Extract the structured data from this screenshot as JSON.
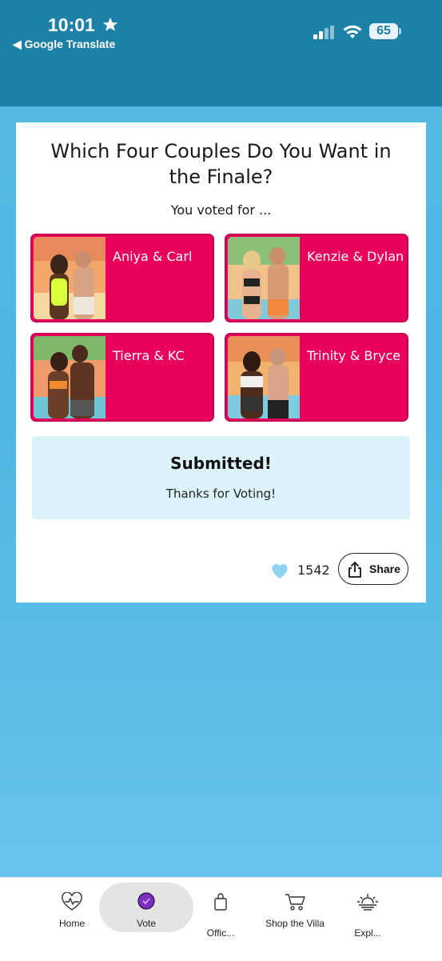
{
  "status": {
    "time": "10:01",
    "back_app": "◀ Google Translate",
    "battery": "65"
  },
  "poll": {
    "title": "Which Four Couples Do You Want in the Finale?",
    "subtitle": "You voted for ...",
    "couples": [
      {
        "name": "Aniya & Carl"
      },
      {
        "name": "Kenzie & Dylan"
      },
      {
        "name": "Tierra & KC"
      },
      {
        "name": "Trinity & Bryce"
      }
    ],
    "submitted_title": "Submitted!",
    "submitted_message": "Thanks for Voting!",
    "likes": "1542",
    "share_label": "Share"
  },
  "tabs": [
    {
      "label": "Home",
      "icon": "heartbeat-icon"
    },
    {
      "label": "Vote",
      "icon": "vote-check-icon"
    },
    {
      "label": "Offic...",
      "icon": "shopping-bag-icon"
    },
    {
      "label": "Shop the Villa",
      "icon": "cart-icon"
    },
    {
      "label": "Expl...",
      "icon": "sunset-icon"
    }
  ],
  "colors": {
    "header": "#1d80a6",
    "accent_pink": "#e8005c",
    "submitted_bg": "#ddf3fb",
    "heart": "#8fd3f2",
    "vote_purple": "#7b2fbf"
  }
}
